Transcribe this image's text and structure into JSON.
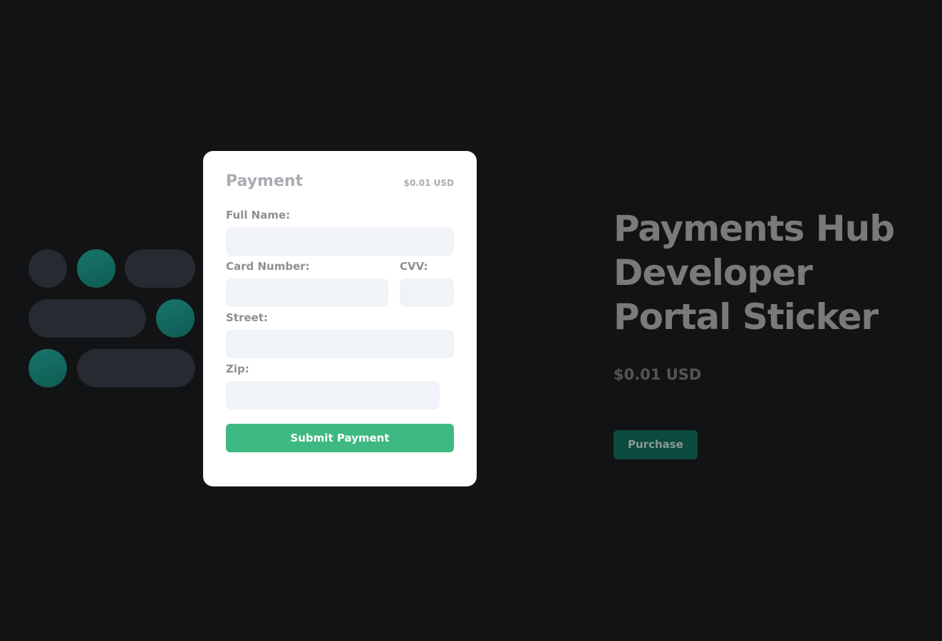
{
  "payment_modal": {
    "title": "Payment",
    "amount": "$0.01 USD",
    "fields": {
      "full_name": {
        "label": "Full Name:",
        "value": "",
        "placeholder": ""
      },
      "card_number": {
        "label": "Card Number:",
        "value": "",
        "placeholder": ""
      },
      "cvv": {
        "label": "CVV:",
        "value": "",
        "placeholder": ""
      },
      "street": {
        "label": "Street:",
        "value": "",
        "placeholder": ""
      },
      "zip": {
        "label": "Zip:",
        "value": "",
        "placeholder": ""
      }
    },
    "submit_label": "Submit Payment"
  },
  "product": {
    "title": "Payments Hub Developer Portal Sticker",
    "price": "$0.01 USD",
    "purchase_label": "Purchase"
  },
  "colors": {
    "background": "#121314",
    "accent_green": "#3eb981",
    "teal_dark": "#0d4a40",
    "sticker_teal": "#17756a",
    "sticker_gray": "#262a31",
    "input_bg": "#f0f3f8"
  }
}
